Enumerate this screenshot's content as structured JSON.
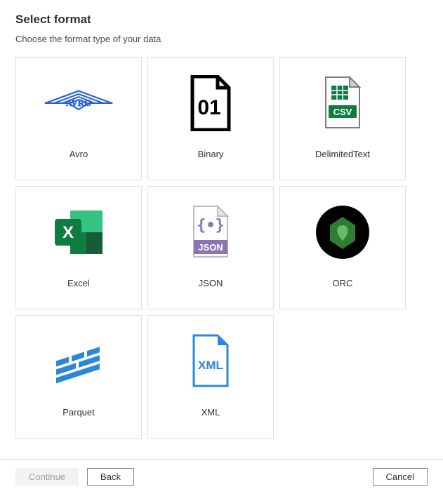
{
  "header": {
    "title": "Select format",
    "subtitle": "Choose the format type of your data"
  },
  "formats": [
    {
      "key": "avro",
      "label": "Avro"
    },
    {
      "key": "binary",
      "label": "Binary"
    },
    {
      "key": "delimited",
      "label": "DelimitedText"
    },
    {
      "key": "excel",
      "label": "Excel"
    },
    {
      "key": "json",
      "label": "JSON"
    },
    {
      "key": "orc",
      "label": "ORC"
    },
    {
      "key": "parquet",
      "label": "Parquet"
    },
    {
      "key": "xml",
      "label": "XML"
    }
  ],
  "footer": {
    "continue_label": "Continue",
    "back_label": "Back",
    "cancel_label": "Cancel"
  }
}
